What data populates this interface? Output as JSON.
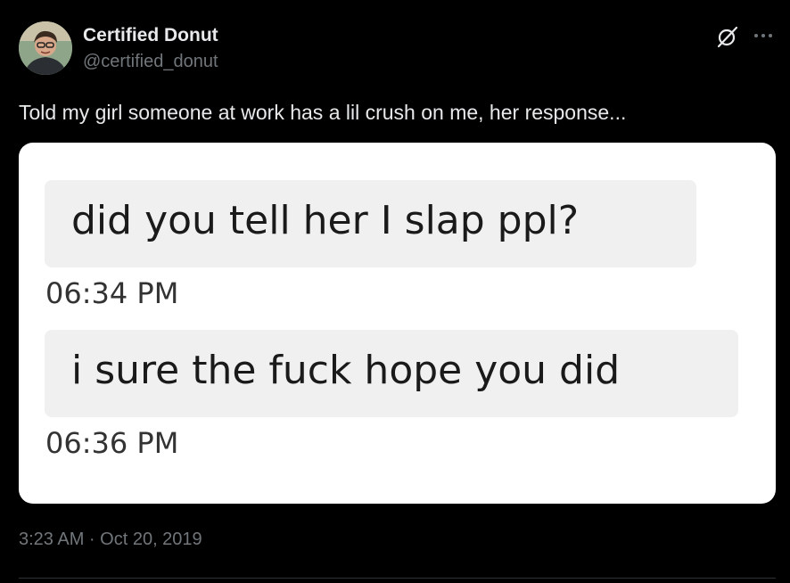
{
  "author": {
    "display_name": "Certified Donut",
    "handle": "@certified_donut"
  },
  "icons": {
    "grok": "grok-icon",
    "more": "more-options-icon"
  },
  "tweet": {
    "text": "Told my girl someone at work has a lil crush on me, her response...",
    "timestamp": "3:23 AM · Oct 20, 2019"
  },
  "media": {
    "messages": [
      {
        "text": "did you tell her I slap ppl?",
        "time": "06:34 PM"
      },
      {
        "text": "i sure the fuck hope you did",
        "time": "06:36 PM"
      }
    ]
  },
  "colors": {
    "background": "#000000",
    "primary_text": "#e7e9ea",
    "secondary_text": "#71767b",
    "bubble": "#f0f0f0",
    "media_background": "#ffffff"
  }
}
